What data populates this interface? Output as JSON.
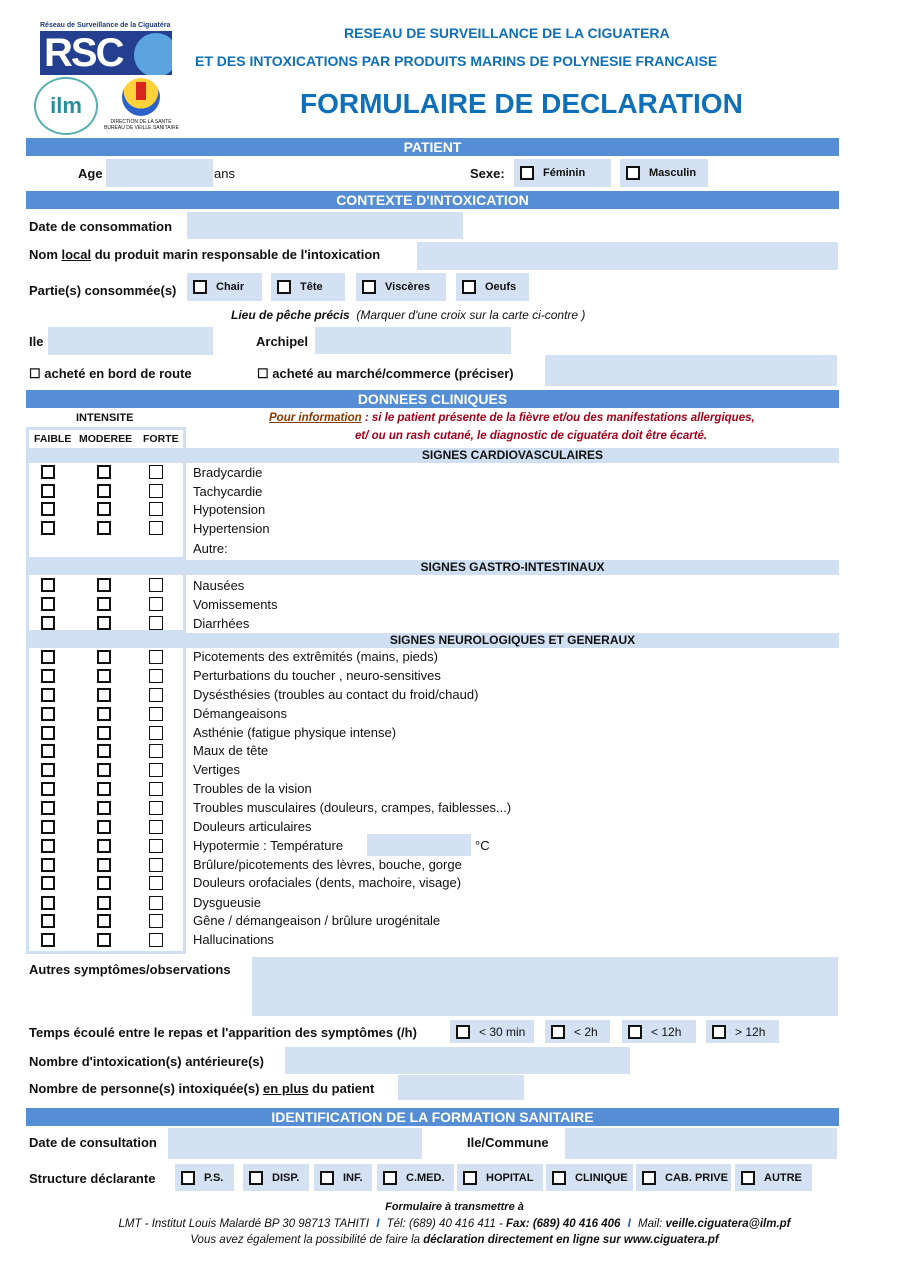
{
  "header": {
    "logo_rsc_caption": "Réseau de Surveillance de la Ciguatéra",
    "logo_rsc_text": "RSC",
    "logo_ilm_text": "ilm",
    "logo_dsante_caption_1": "DIRECTION DE LA SANTE",
    "logo_dsante_caption_2": "BUREAU DE VEILLE SANITAIRE",
    "line1": "RESEAU DE SURVEILLANCE DE LA CIGUATERA",
    "line2": "ET DES INTOXICATIONS PAR PRODUITS MARINS DE POLYNESIE FRANCAISE",
    "title": "FORMULAIRE DE DECLARATION",
    "brand_color": "#0070c0"
  },
  "patient": {
    "section_title": "PATIENT",
    "age_label": "Age",
    "age_value": "",
    "age_unit": "ans",
    "sexe_label": "Sexe:",
    "sexe_options": [
      "Féminin",
      "Masculin"
    ]
  },
  "contexte": {
    "section_title": "CONTEXTE D'INTOXICATION",
    "date_label": "Date de consommation",
    "date_value": "",
    "nom_label_pre": "Nom ",
    "nom_label_underlined": "local",
    "nom_label_post": " du produit marin responsable de l'intoxication",
    "nom_value": "",
    "parties_label": "Partie(s) consommée(s)",
    "parties_options": [
      "Chair",
      "Tête",
      "Viscères",
      "Oeufs"
    ],
    "lieu_title": "Lieu de pêche précis",
    "lieu_hint": "(Marquer d'une croix sur la carte ci-contre )",
    "ile_label": "Ile",
    "ile_value": "",
    "archipel_label": "Archipel",
    "archipel_value": "",
    "achat_route": "☐ acheté en bord de route",
    "achat_marche": "☐ acheté au marché/commerce  (préciser)",
    "achat_marche_value": ""
  },
  "clinique": {
    "section_title": "DONNEES CLINIQUES",
    "intensite_label": "INTENSITE",
    "intensite_levels": [
      "FAIBLE",
      "MODEREE",
      "FORTE"
    ],
    "info_link": "Pour information",
    "info_line1": " : si le patient présente de la fièvre et/ou des manifestations allergiques,",
    "info_line2": "et/ ou  un rash cutané, le diagnostic de ciguatéra doit être écarté.",
    "groups": [
      {
        "title": "SIGNES CARDIOVASCULAIRES",
        "items": [
          "Bradycardie",
          "Tachycardie",
          "Hypotension",
          "Hypertension"
        ],
        "extra": "Autre:"
      },
      {
        "title": "SIGNES GASTRO-INTESTINAUX",
        "items": [
          "Nausées",
          "Vomissements",
          "Diarrhées"
        ]
      },
      {
        "title": "SIGNES NEUROLOGIQUES ET GENERAUX",
        "items": [
          "Picotements des extrêmités (mains, pieds)",
          "Perturbations du toucher , neuro-sensitives",
          "Dysésthésies (troubles au contact du froid/chaud)",
          "Démangeaisons",
          "Asthénie (fatigue physique intense)",
          "Maux de tête",
          "Vertiges",
          "Troubles de la vision",
          "Troubles musculaires (douleurs, crampes, faiblesses...)",
          "Douleurs articulaires",
          "Hypotermie : Température",
          "Brûlure/picotements des lèvres, bouche, gorge",
          "Douleurs orofaciales (dents, machoire, visage)",
          "Dysgueusie",
          "Gêne / démangeaison / brûlure urogénitale",
          "Hallucinations"
        ]
      }
    ],
    "temperature_value": "",
    "temperature_unit": "°C",
    "autres_label": "Autres symptômes/observations",
    "autres_value": "",
    "temps_label": "Temps écoulé entre le repas et l'apparition des symptômes (/h)",
    "temps_options": [
      "< 30 min",
      "< 2h",
      "< 12h",
      "> 12h"
    ],
    "anterieures_label": "Nombre d'intoxication(s) antérieure(s)",
    "anterieures_value": "",
    "personnes_label_pre": "Nombre de personne(s) intoxiquée(s) ",
    "personnes_label_underlined": "en plus",
    "personnes_label_post": " du patient",
    "personnes_value": ""
  },
  "formation": {
    "section_title": "IDENTIFICATION DE LA FORMATION SANITAIRE",
    "date_label": "Date de consultation",
    "date_value": "",
    "commune_label": "Ile/Commune",
    "commune_value": "",
    "structure_label": "Structure déclarante",
    "structure_options": [
      "P.S.",
      "DISP.",
      "INF.",
      "C.MED.",
      "HOPITAL",
      "CLINIQUE",
      "CAB. PRIVE",
      "AUTRE"
    ]
  },
  "footer": {
    "line1": "Formulaire à transmettre à",
    "addr": "LMT - Institut Louis Malardé BP 30 98713 TAHITI",
    "sep": "I",
    "tel": "Tél: (689) 40 416 411 - ",
    "fax": "Fax: (689) 40 416 406",
    "mail_label": "Mail: ",
    "mail": "veille.ciguatera@ilm.pf",
    "line3_pre": "Vous avez également la possibilité de faire la ",
    "line3_bold": "déclaration directement en ligne sur www.ciguatera.pf"
  }
}
